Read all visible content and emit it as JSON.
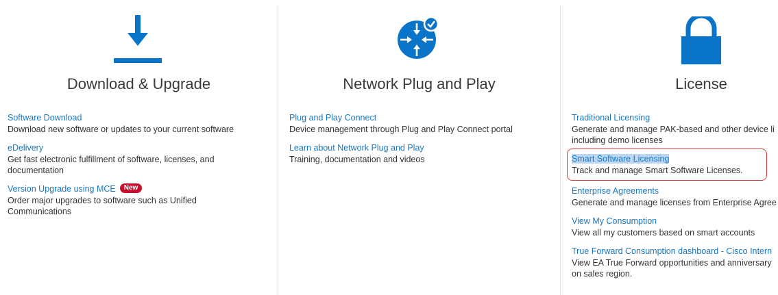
{
  "columns": [
    {
      "title": "Download & Upgrade",
      "icon": "download-icon",
      "items": [
        {
          "link": "Software Download",
          "desc": "Download new software or updates to your current software"
        },
        {
          "link": "eDelivery",
          "desc": "Get fast electronic fulfillment of software, licenses, and documentation"
        },
        {
          "link": "Version Upgrade using MCE",
          "badge": "New",
          "desc": "Order major upgrades to software such as Unified Communications"
        }
      ]
    },
    {
      "title": "Network Plug and Play",
      "icon": "network-plug-and-play-icon",
      "items": [
        {
          "link": "Plug and Play Connect",
          "desc": "Device management through Plug and Play Connect portal"
        },
        {
          "link": "Learn about Network Plug and Play",
          "desc": "Training, documentation and videos"
        }
      ]
    },
    {
      "title": "License",
      "icon": "lock-icon",
      "items": [
        {
          "link": "Traditional Licensing",
          "desc": "Generate and manage PAK-based and other device li",
          "desc2": "including demo licenses"
        },
        {
          "link": "Smart Software Licensing",
          "desc": "Track and manage Smart Software Licenses."
        },
        {
          "link": "Enterprise Agreements",
          "desc": "Generate and manage licenses from Enterprise Agree"
        },
        {
          "link": "View My Consumption",
          "desc": "View all my customers based on smart accounts"
        },
        {
          "link": "True Forward Consumption dashboard - Cisco Intern",
          "desc": "View EA True Forward opportunities and anniversary",
          "desc2": "on sales region."
        }
      ]
    }
  ],
  "colors": {
    "accent": "#0a74c8",
    "link": "#1a78c2",
    "badge": "#c8102e",
    "highlight_border": "#d23a3a",
    "selection": "#bcd7f3"
  }
}
